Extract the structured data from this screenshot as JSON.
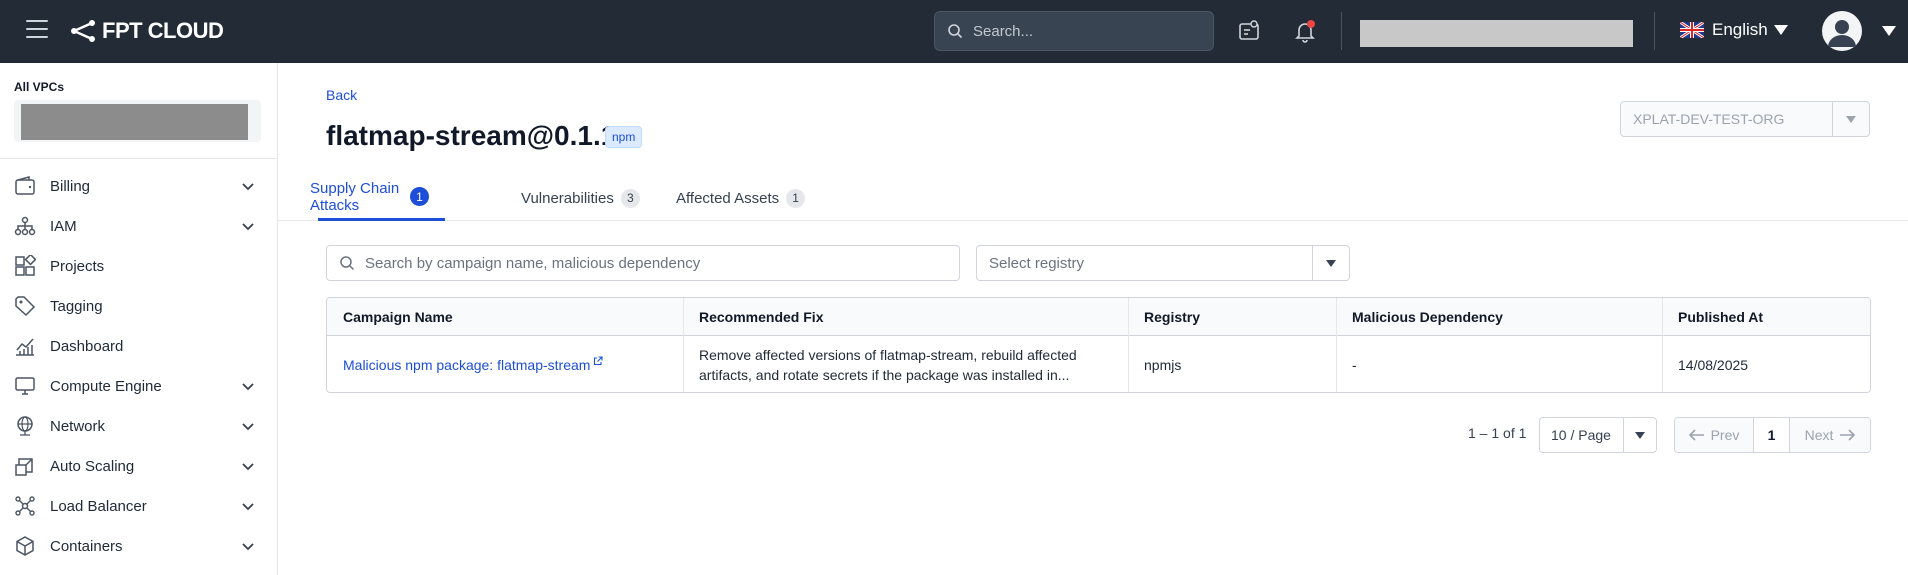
{
  "topbar": {
    "logo_text": "FPT CLOUD",
    "search_placeholder": "Search...",
    "language": "English"
  },
  "sidebar": {
    "vpc_label": "All VPCs",
    "items": [
      {
        "label": "Billing",
        "icon": "wallet-icon",
        "expandable": true
      },
      {
        "label": "IAM",
        "icon": "org-chart-icon",
        "expandable": true
      },
      {
        "label": "Projects",
        "icon": "projects-grid-icon",
        "expandable": false
      },
      {
        "label": "Tagging",
        "icon": "tag-icon",
        "expandable": false
      },
      {
        "label": "Dashboard",
        "icon": "chart-icon",
        "expandable": false
      },
      {
        "label": "Compute Engine",
        "icon": "monitor-icon",
        "expandable": true
      },
      {
        "label": "Network",
        "icon": "globe-icon",
        "expandable": true
      },
      {
        "label": "Auto Scaling",
        "icon": "scaling-icon",
        "expandable": true
      },
      {
        "label": "Load Balancer",
        "icon": "load-balancer-icon",
        "expandable": true
      },
      {
        "label": "Containers",
        "icon": "container-icon",
        "expandable": true
      }
    ]
  },
  "page": {
    "back_label": "Back",
    "title": "flatmap-stream@0.1.1",
    "badge": "npm",
    "org": "XPLAT-DEV-TEST-ORG"
  },
  "tabs": [
    {
      "label": "Supply Chain Attacks",
      "count": "1",
      "active": true
    },
    {
      "label": "Vulnerabilities",
      "count": "3",
      "active": false
    },
    {
      "label": "Affected Assets",
      "count": "1",
      "active": false
    }
  ],
  "filters": {
    "search_placeholder": "Search by campaign name, malicious dependency",
    "registry_placeholder": "Select registry"
  },
  "table": {
    "headers": [
      "Campaign Name",
      "Recommended Fix",
      "Registry",
      "Malicious Dependency",
      "Published At"
    ],
    "rows": [
      {
        "campaign": "Malicious npm package: flatmap-stream",
        "fix": "Remove affected versions of flatmap-stream, rebuild affected artifacts, and rotate secrets if the package was installed in...",
        "registry": "npmjs",
        "dependency": "-",
        "published": "14/08/2025"
      }
    ]
  },
  "pagination": {
    "info": "1 – 1 of 1",
    "page_size": "10 / Page",
    "prev": "Prev",
    "current": "1",
    "next": "Next"
  },
  "colors": {
    "topbar_bg": "#222b36",
    "accent": "#1d4ed8",
    "notification_dot": "#ef4444"
  }
}
